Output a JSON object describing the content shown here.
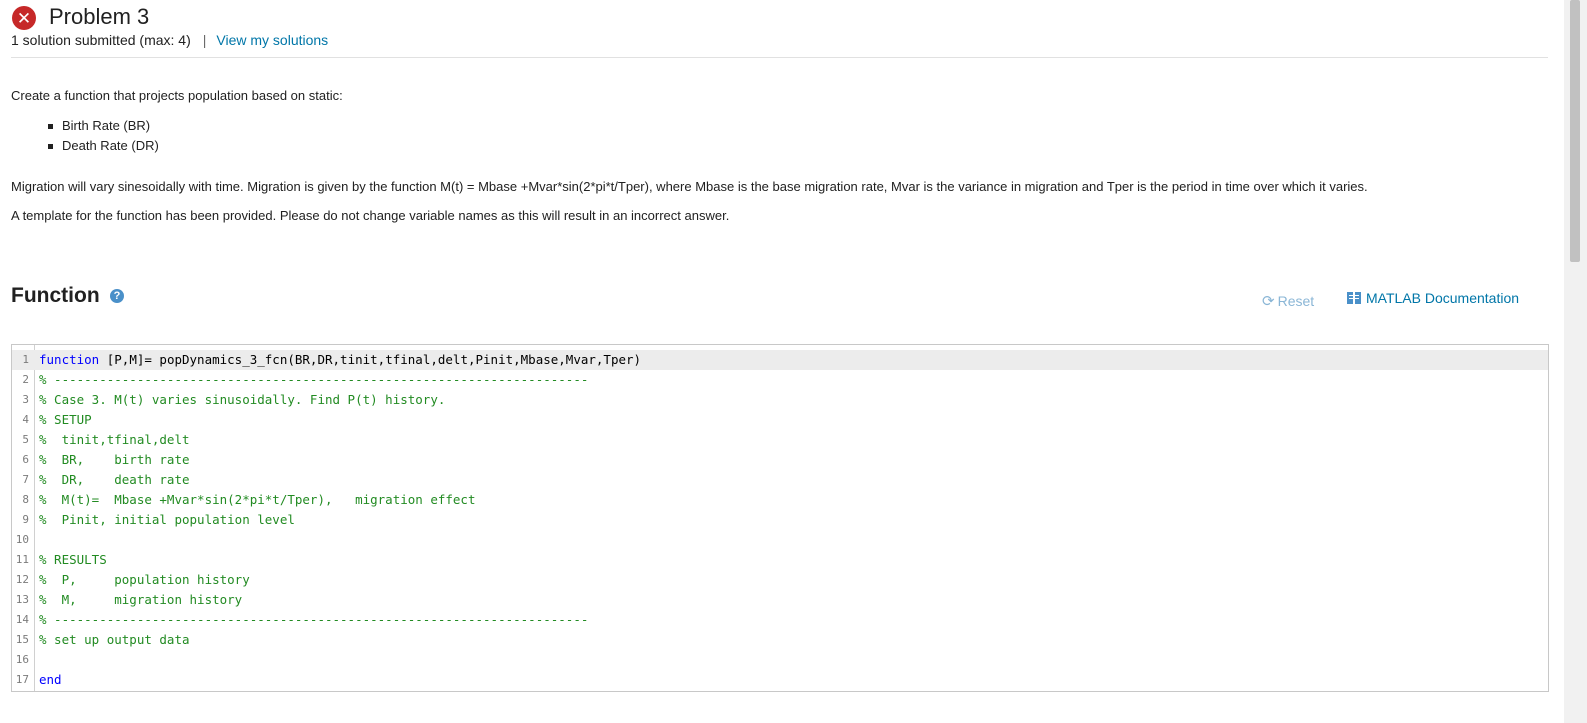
{
  "header": {
    "title": "Problem 3",
    "status": "failed",
    "status_color": "#c62828",
    "submission_info": "1 solution submitted (max: 4)",
    "separator": "|",
    "view_solutions_link": "View my solutions"
  },
  "description": {
    "intro": "Create a function that projects population based on static:",
    "bullets": [
      "Birth Rate (BR)",
      "Death Rate  (DR)"
    ],
    "migration_text": "Migration will vary sinesoidally with time.  Migration is given by the function M(t) = Mbase +Mvar*sin(2*pi*t/Tper), where Mbase is the base migration rate, Mvar is the variance in migration and Tper is the period in time over which it varies.",
    "template_text": "A template for the function has been provided.  Please do not change variable names as this will result in an incorrect answer."
  },
  "function_section": {
    "title": "Function",
    "help_icon": "question-circle-icon",
    "reset_label": "Reset",
    "reset_icon": "refresh-icon",
    "doc_label": "MATLAB Documentation",
    "doc_icon": "book-icon",
    "link_color": "#0076a8"
  },
  "editor": {
    "active_line": 1,
    "lines": [
      {
        "num": "1",
        "kw": "function",
        "text": " [P,M]= popDynamics_3_fcn(BR,DR,tinit,tfinal,delt,Pinit,Mbase,Mvar,Tper)",
        "comment": ""
      },
      {
        "num": "2",
        "kw": "",
        "text": "",
        "comment": "% -----------------------------------------------------------------------"
      },
      {
        "num": "3",
        "kw": "",
        "text": "",
        "comment": "% Case 3. M(t) varies sinusoidally. Find P(t) history."
      },
      {
        "num": "4",
        "kw": "",
        "text": "",
        "comment": "% SETUP"
      },
      {
        "num": "5",
        "kw": "",
        "text": "",
        "comment": "%  tinit,tfinal,delt"
      },
      {
        "num": "6",
        "kw": "",
        "text": "",
        "comment": "%  BR,    birth rate"
      },
      {
        "num": "7",
        "kw": "",
        "text": "",
        "comment": "%  DR,    death rate"
      },
      {
        "num": "8",
        "kw": "",
        "text": "",
        "comment": "%  M(t)=  Mbase +Mvar*sin(2*pi*t/Tper),   migration effect"
      },
      {
        "num": "9",
        "kw": "",
        "text": "",
        "comment": "%  Pinit, initial population level"
      },
      {
        "num": "10",
        "kw": "",
        "text": "",
        "comment": ""
      },
      {
        "num": "11",
        "kw": "",
        "text": "",
        "comment": "% RESULTS"
      },
      {
        "num": "12",
        "kw": "",
        "text": "",
        "comment": "%  P,     population history"
      },
      {
        "num": "13",
        "kw": "",
        "text": "",
        "comment": "%  M,     migration history"
      },
      {
        "num": "14",
        "kw": "",
        "text": "",
        "comment": "% -----------------------------------------------------------------------"
      },
      {
        "num": "15",
        "kw": "",
        "text": "",
        "comment": "% set up output data"
      },
      {
        "num": "16",
        "kw": "",
        "text": "",
        "comment": ""
      },
      {
        "num": "17",
        "kw": "end",
        "text": "",
        "comment": ""
      }
    ]
  }
}
